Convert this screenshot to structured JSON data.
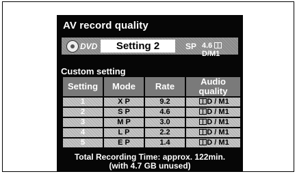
{
  "title": "AV record quality",
  "dvd_bar": {
    "disc_label": "DVD",
    "setting_value": "Setting 2",
    "mode": "SP",
    "rate": "4.6",
    "audio": "D/M1",
    "disc_icon": "dvd-disc-icon"
  },
  "custom_setting_label": "Custom setting",
  "table": {
    "headers": [
      "Setting",
      "Mode",
      "Rate",
      "Audio quality"
    ],
    "rows": [
      {
        "setting": "1",
        "mode": "X P",
        "rate": "9.2",
        "audio": "D / M1"
      },
      {
        "setting": "2",
        "mode": "S P",
        "rate": "4.6",
        "audio": "D / M1"
      },
      {
        "setting": "3",
        "mode": "M P",
        "rate": "3.0",
        "audio": "D / M1"
      },
      {
        "setting": "4",
        "mode": "L P",
        "rate": "2.2",
        "audio": "D / M1"
      },
      {
        "setting": "5",
        "mode": "E P",
        "rate": "1.4",
        "audio": "D / M1"
      }
    ]
  },
  "footer": {
    "line1": "Total Recording Time: approx. 122min.",
    "line2": "(with 4.7 GB unused)"
  }
}
